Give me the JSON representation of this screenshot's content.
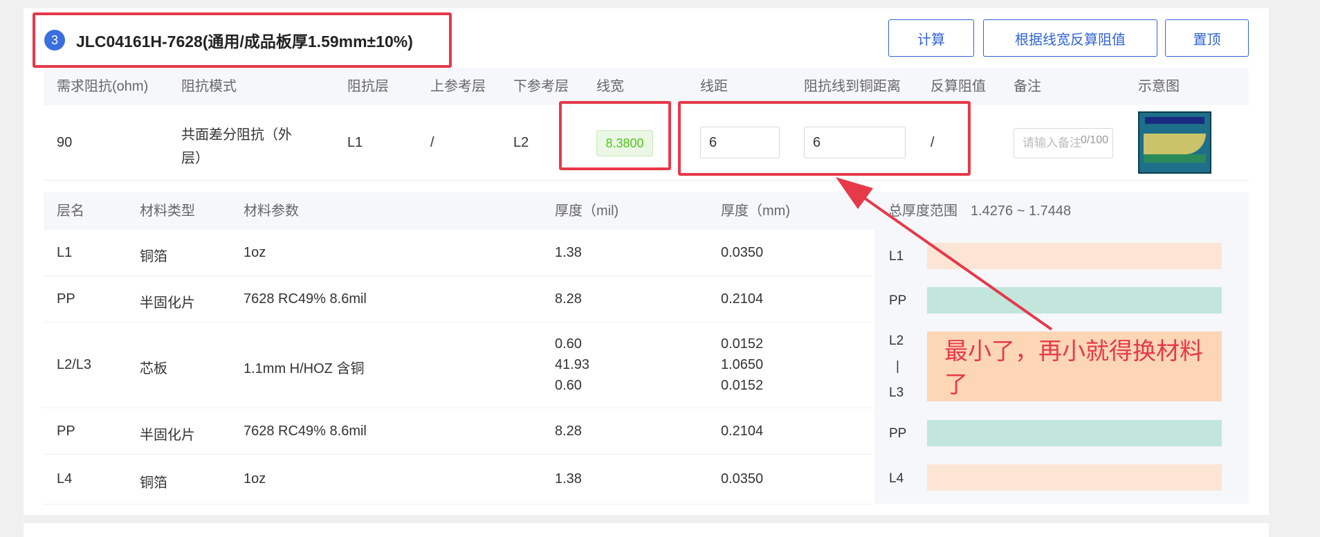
{
  "header": {
    "index": "3",
    "title": "JLC04161H-7628(通用/成品板厚1.59mm±10%)"
  },
  "buttons": {
    "calc": "计算",
    "reverse": "根据线宽反算阻值",
    "top": "置顶"
  },
  "impedance": {
    "headers": [
      "需求阻抗(ohm)",
      "阻抗模式",
      "阻抗层",
      "上参考层",
      "下参考层",
      "线宽",
      "线距",
      "阻抗线到铜距离",
      "反算阻值",
      "备注",
      "示意图"
    ],
    "row": {
      "ohm": "90",
      "mode_line1": "共面差分阻抗（外",
      "mode_line2": "层）",
      "layer": "L1",
      "upper_ref": "/",
      "lower_ref": "L2",
      "width": "8.3800",
      "spacing": "6",
      "to_copper": "6",
      "reverse": "/",
      "note_placeholder": "请输入备注",
      "note_count": "0/100"
    }
  },
  "stack": {
    "headers": [
      "层名",
      "材料类型",
      "材料参数",
      "厚度（mil)",
      "厚度（mm)"
    ],
    "total_label": "总厚度范围",
    "total_value": "1.4276 ~ 1.7448",
    "rows": [
      {
        "name": "L1",
        "type": "铜箔",
        "param": "1oz",
        "mil": [
          "1.38"
        ],
        "mm": [
          "0.0350"
        ]
      },
      {
        "name": "PP",
        "type": "半固化片",
        "param": "7628 RC49% 8.6mil",
        "mil": [
          "8.28"
        ],
        "mm": [
          "0.2104"
        ]
      },
      {
        "name": "L2/L3",
        "type": "芯板",
        "param": "1.1mm H/HOZ 含铜",
        "mil": [
          "0.60",
          "41.93",
          "0.60"
        ],
        "mm": [
          "0.0152",
          "1.0650",
          "0.0152"
        ]
      },
      {
        "name": "PP",
        "type": "半固化片",
        "param": "7628 RC49% 8.6mil",
        "mil": [
          "8.28"
        ],
        "mm": [
          "0.2104"
        ]
      },
      {
        "name": "L4",
        "type": "铜箔",
        "param": "1oz",
        "mil": [
          "1.38"
        ],
        "mm": [
          "0.0350"
        ]
      }
    ],
    "visual_labels": {
      "l1": "L1",
      "pp1": "PP",
      "l2": "L2",
      "sep": "|",
      "l3": "L3",
      "pp2": "PP",
      "l4": "L4"
    }
  },
  "annotation": {
    "text": "最小了，再小就得换材料了"
  },
  "colors": {
    "accent": "#2f63d8",
    "annotation": "#e6394a",
    "copper": "#fde5d6",
    "prepreg": "#c2e6dc",
    "core": "#fdd6b6",
    "width_pill": "#52c41a"
  }
}
